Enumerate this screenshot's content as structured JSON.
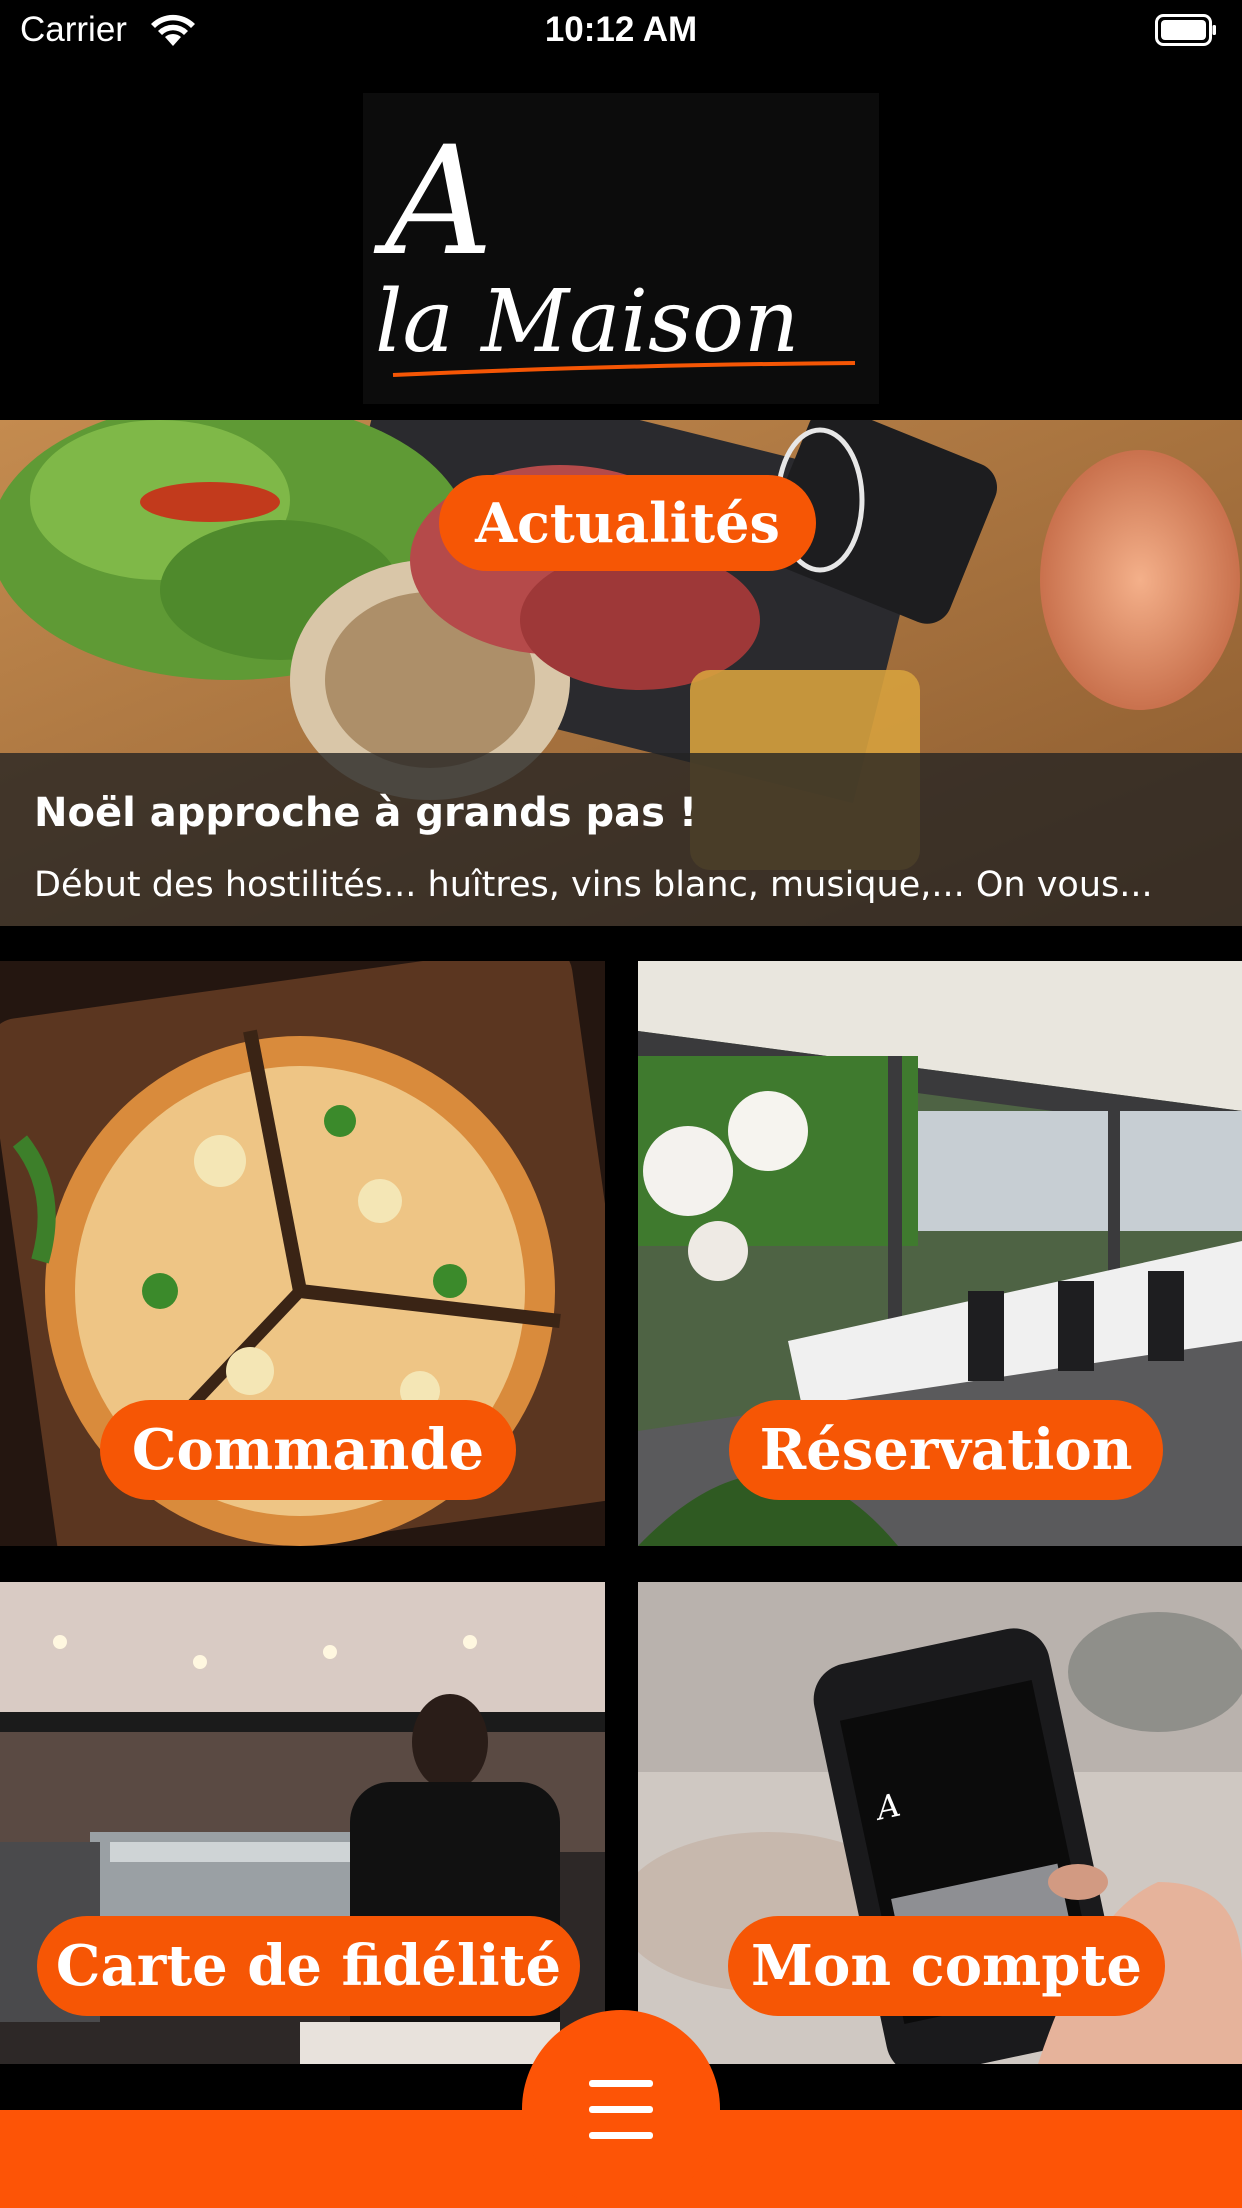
{
  "status_bar": {
    "carrier": "Carrier",
    "time": "10:12 AM",
    "icons": [
      "wifi-icon",
      "battery-icon"
    ]
  },
  "logo": {
    "text_line1": "A",
    "text_line2": "la Maison"
  },
  "news": {
    "button_label": "Actualités",
    "title": "Noël approche à grands pas !",
    "description": "Début des hostilités... huîtres, vins blanc, musique,... On vous..."
  },
  "tiles": [
    {
      "label": "Commande"
    },
    {
      "label": "Réservation"
    },
    {
      "label": "Carte de fidélité"
    },
    {
      "label": "Mon compte"
    }
  ],
  "bottom_nav": {
    "menu_icon": "hamburger-menu-icon"
  },
  "colors": {
    "accent": "#fd5406",
    "pill": "#f65605",
    "background": "#000000",
    "text": "#ffffff"
  }
}
